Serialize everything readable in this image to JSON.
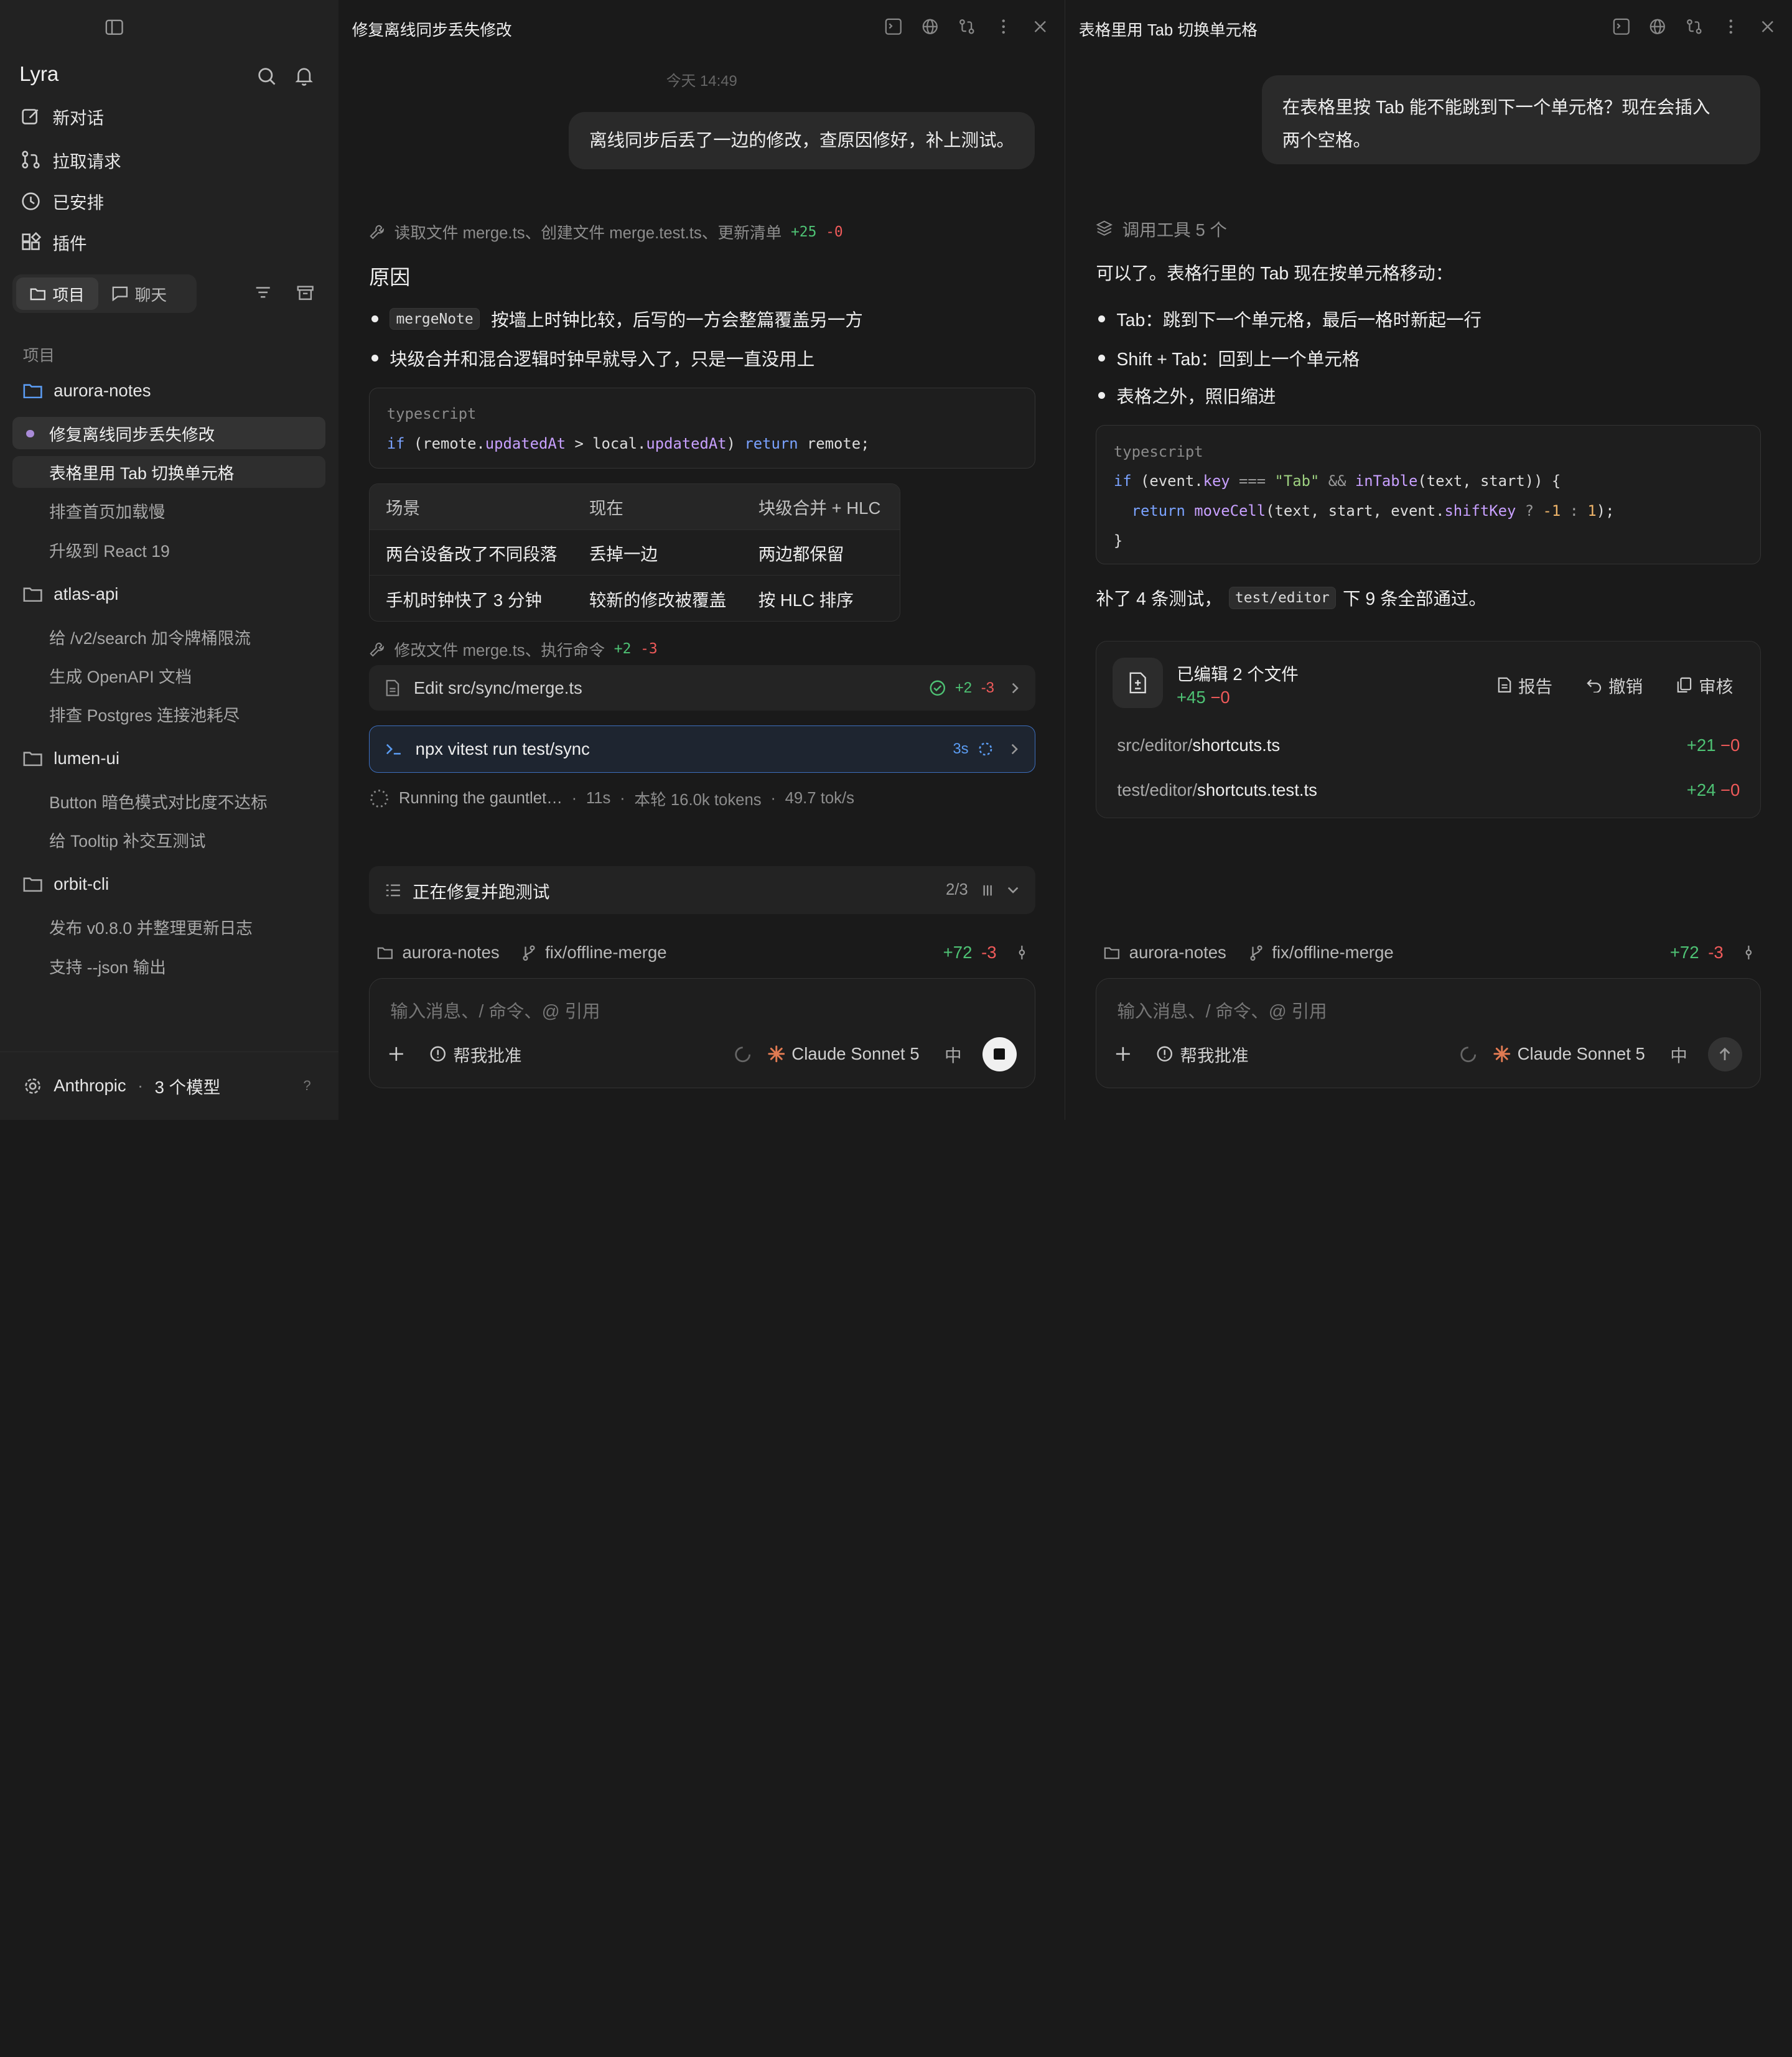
{
  "sidebar": {
    "brand": "Lyra",
    "menu": [
      {
        "label": "新对话",
        "icon": "compose-icon"
      },
      {
        "label": "拉取请求",
        "icon": "pull-request-icon"
      },
      {
        "label": "已安排",
        "icon": "clock-icon"
      },
      {
        "label": "插件",
        "icon": "plugin-icon"
      }
    ],
    "tabs": {
      "projects": "项目",
      "chats": "聊天",
      "active": "projects"
    },
    "section_label": "项目",
    "projects": [
      {
        "name": "aurora-notes",
        "chats": [
          "修复离线同步丢失修改",
          "表格里用 Tab 切换单元格",
          "排查首页加载慢",
          "升级到 React 19"
        ]
      },
      {
        "name": "atlas-api",
        "chats": [
          "给 /v2/search 加令牌桶限流",
          "生成 OpenAPI 文档",
          "排查 Postgres 连接池耗尽"
        ]
      },
      {
        "name": "lumen-ui",
        "chats": [
          "Button 暗色模式对比度不达标",
          "给 Tooltip 补交互测试"
        ]
      },
      {
        "name": "orbit-cli",
        "chats": [
          "发布 v0.8.0 并整理更新日志",
          "支持 --json 输出"
        ]
      }
    ],
    "footer": {
      "provider": "Anthropic",
      "models": "3 个模型",
      "help": "?"
    }
  },
  "pane1": {
    "title": "修复离线同步丢失修改",
    "timestamp": "今天 14:49",
    "user_msg": "离线同步后丢了一边的修改，查原因修好，补上测试。",
    "tool1": {
      "text": "读取文件 merge.ts、创建文件 merge.test.ts、更新清单",
      "plus": "+25",
      "minus": "-0"
    },
    "heading": "原因",
    "bullet1_code": "mergeNote",
    "bullet1_text": "按墙上时钟比较，后写的一方会整篇覆盖另一方",
    "bullet2": "块级合并和混合逻辑时钟早就导入了，只是一直没用上",
    "code_lang": "typescript",
    "table": {
      "headers": [
        "场景",
        "现在",
        "块级合并 + HLC"
      ],
      "rows": [
        [
          "两台设备改了不同段落",
          "丢掉一边",
          "两边都保留"
        ],
        [
          "手机时钟快了 3 分钟",
          "较新的修改被覆盖",
          "按 HLC 排序"
        ]
      ]
    },
    "tool2": {
      "text": "修改文件 merge.ts、执行命令",
      "plus": "+2",
      "minus": "-3"
    },
    "edit_row": {
      "label": "Edit src/sync/merge.ts",
      "plus": "+2",
      "minus": "-3"
    },
    "cmd_row": {
      "label": "npx vitest run test/sync",
      "time": "3s"
    },
    "running": {
      "text": "Running the gauntlet…",
      "elapsed": "11s",
      "tokens": "本轮 16.0k tokens",
      "rate": "49.7 tok/s"
    },
    "plan": {
      "label": "正在修复并跑测试",
      "progress": "2/3"
    },
    "footer": {
      "project": "aurora-notes",
      "branch": "fix/offline-merge",
      "plus": "+72",
      "minus": "-3"
    },
    "composer": {
      "placeholder": "输入消息、/ 命令、@ 引用",
      "approve": "帮我批准",
      "model": "Claude Sonnet 5",
      "lang": "中"
    }
  },
  "pane2": {
    "title": "表格里用 Tab 切换单元格",
    "user_msg_1": "在表格里按 Tab 能不能跳到下一个单元格？现在会插入",
    "user_msg_2": "两个空格。",
    "tools": "调用工具 5 个",
    "intro": "可以了。表格行里的 Tab 现在按单元格移动：",
    "bullets": [
      "Tab：跳到下一个单元格，最后一格时新起一行",
      "Shift + Tab：回到上一个单元格",
      "表格之外，照旧缩进"
    ],
    "code_lang": "typescript",
    "summary_pre": "补了 4 条测试，",
    "summary_code": "test/editor",
    "summary_post": "下 9 条全部通过。",
    "files_card": {
      "title": "已编辑 2 个文件",
      "plus": "+45",
      "minus": "−0",
      "actions": [
        "报告",
        "撤销",
        "审核"
      ],
      "files": [
        {
          "dir": "src/editor/",
          "name": "shortcuts.ts",
          "plus": "+21",
          "minus": "−0"
        },
        {
          "dir": "test/editor/",
          "name": "shortcuts.test.ts",
          "plus": "+24",
          "minus": "−0"
        }
      ]
    },
    "footer": {
      "project": "aurora-notes",
      "branch": "fix/offline-merge",
      "plus": "+72",
      "minus": "-3"
    },
    "composer": {
      "placeholder": "输入消息、/ 命令、@ 引用",
      "approve": "帮我批准",
      "model": "Claude Sonnet 5",
      "lang": "中"
    }
  }
}
